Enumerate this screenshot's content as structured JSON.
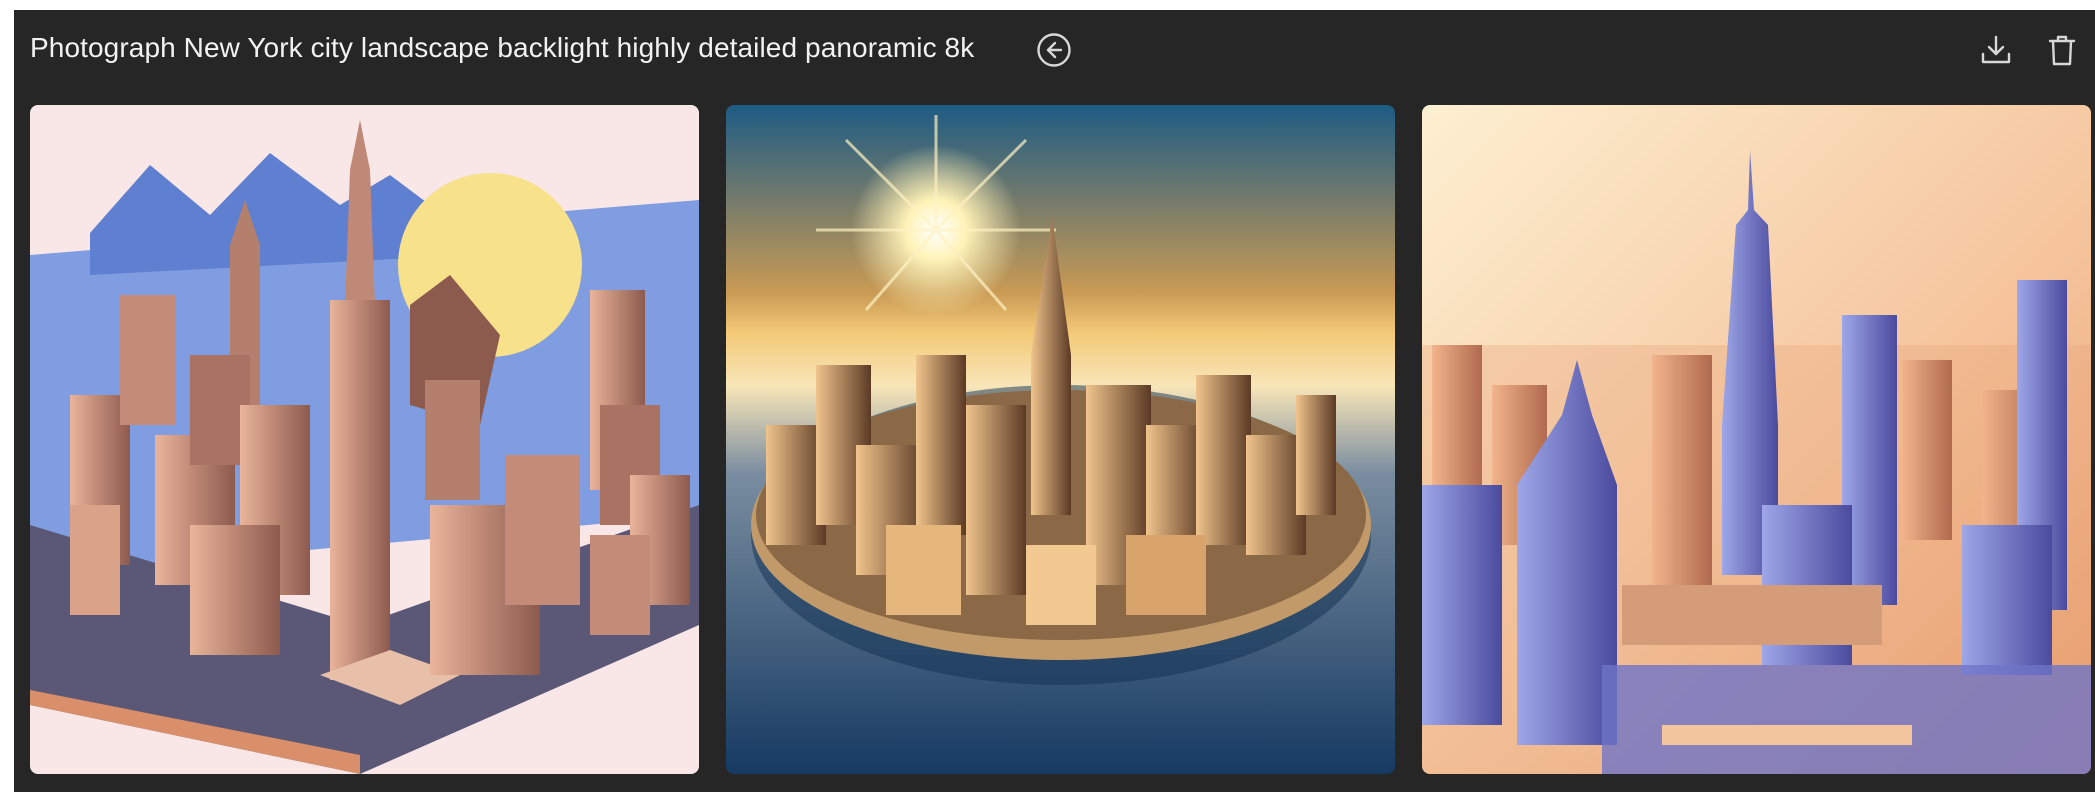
{
  "header": {
    "prompt_text": "Photograph New York city landscape backlight highly detailed panoramic 8k",
    "back_icon": "arrow-left-circle-icon",
    "download_icon": "download-icon",
    "delete_icon": "trash-icon"
  },
  "gallery": {
    "images": [
      {
        "style": "isometric low-poly illustration",
        "colors": {
          "sky": "#7f9de0",
          "sun": "#f7e18b",
          "buildings": "#b47f6c"
        }
      },
      {
        "style": "circular island panorama at sunrise",
        "colors": {
          "sky": "#1f5f86",
          "sun": "#fff3b8",
          "water": "#163a62"
        }
      },
      {
        "style": "flat vector skyline at sunset",
        "colors": {
          "sky": "#f5c39b",
          "buildings": "#6f74c7",
          "accent": "#e79966"
        }
      }
    ]
  },
  "colors": {
    "panel_background": "#262626",
    "text": "#f2f2f2",
    "icon": "#d8d8d8"
  }
}
